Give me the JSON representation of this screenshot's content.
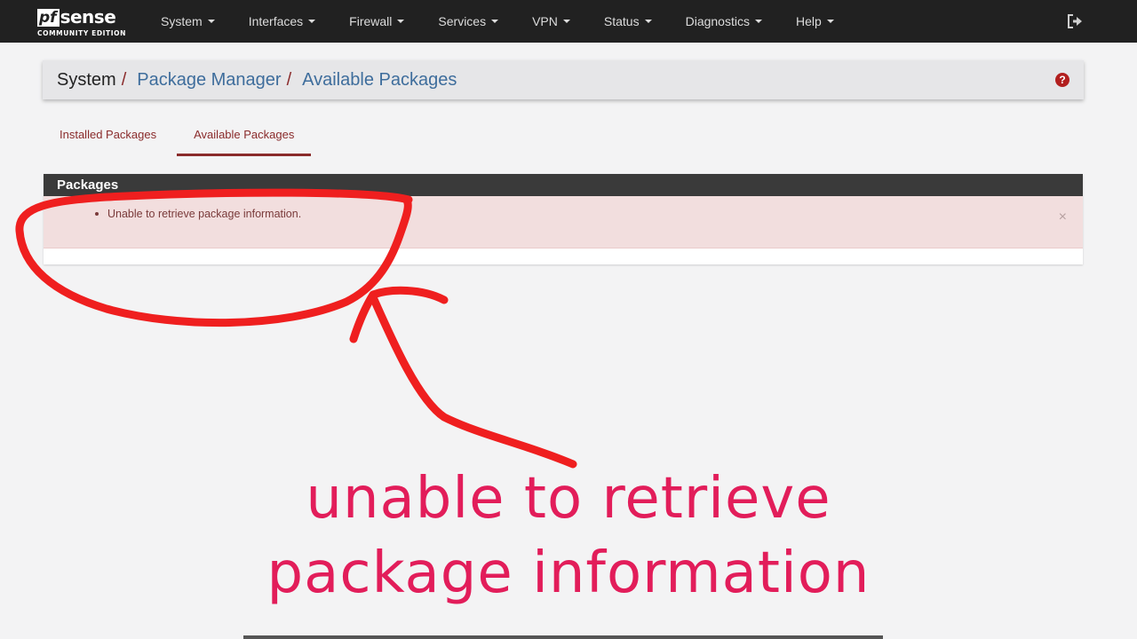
{
  "navbar": {
    "brand": {
      "pf": "pf",
      "sense": "sense",
      "edition": "COMMUNITY EDITION"
    },
    "menu": [
      {
        "label": "System"
      },
      {
        "label": "Interfaces"
      },
      {
        "label": "Firewall"
      },
      {
        "label": "Services"
      },
      {
        "label": "VPN"
      },
      {
        "label": "Status"
      },
      {
        "label": "Diagnostics"
      },
      {
        "label": "Help"
      }
    ],
    "logout_icon": "logout-icon"
  },
  "breadcrumb": {
    "root": "System",
    "sep": "/",
    "items": [
      "Package Manager",
      "Available Packages"
    ],
    "help_icon": "question-circle-icon",
    "help_glyph": "?"
  },
  "tabs": [
    {
      "label": "Installed Packages",
      "active": false
    },
    {
      "label": "Available Packages",
      "active": true
    }
  ],
  "packages_panel": {
    "heading": "Packages",
    "alert_message": "Unable to retrieve package information.",
    "close_glyph": "×"
  },
  "annotation": {
    "caption_line1": "unable to retrieve",
    "caption_line2": "package information",
    "caption_color": "#e21d5a",
    "marker_color": "#ef1f1f"
  },
  "colors": {
    "navbar_bg": "#212121",
    "accent": "#8a2b2b",
    "link": "#3e6d9c",
    "alert_bg": "#f2dede"
  }
}
